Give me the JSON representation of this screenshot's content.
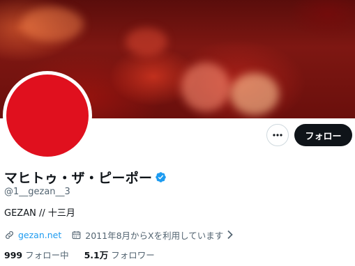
{
  "profile": {
    "display_name": "マヒトゥ・ザ・ピーポー",
    "handle": "@1__gezan__3",
    "bio": "GEZAN // 十三月",
    "website": "gezan.net",
    "joined": "2011年8月からXを利用しています",
    "verified": true
  },
  "actions": {
    "follow_label": "フォロー",
    "more_icon": "more-horizontal-icon"
  },
  "stats": {
    "following_count": "999",
    "following_label": "フォロー中",
    "followers_count": "5.1万",
    "followers_label": "フォロワー"
  },
  "colors": {
    "accent": "#1d9bf0",
    "avatar": "#e0101e",
    "follow_button": "#0f1419",
    "secondary_text": "#536471"
  }
}
